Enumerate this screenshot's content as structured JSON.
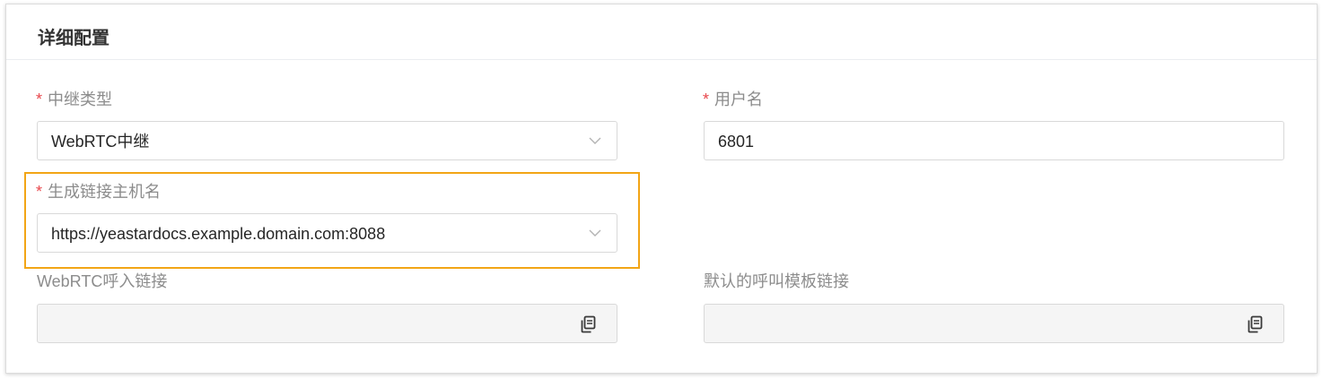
{
  "section": {
    "title": "详细配置"
  },
  "fields": {
    "trunk_type": {
      "required": "*",
      "label": "中继类型",
      "value": "WebRTC中继"
    },
    "username": {
      "required": "*",
      "label": "用户名",
      "value": "6801"
    },
    "link_hostname": {
      "required": "*",
      "label": "生成链接主机名",
      "value": "https://yeastardocs.example.domain.com:8088"
    },
    "webrtc_inbound_link": {
      "label": "WebRTC呼入链接",
      "value": ""
    },
    "default_call_template_link": {
      "label": "默认的呼叫模板链接",
      "value": ""
    }
  },
  "icons": {
    "dropdown": "chevron-down-icon",
    "copy": "copy-icon"
  },
  "colors": {
    "required_mark": "#e8474c",
    "highlight_border": "#f2a516",
    "label": "#8c8c8c",
    "disabled_background": "#f5f5f5"
  }
}
